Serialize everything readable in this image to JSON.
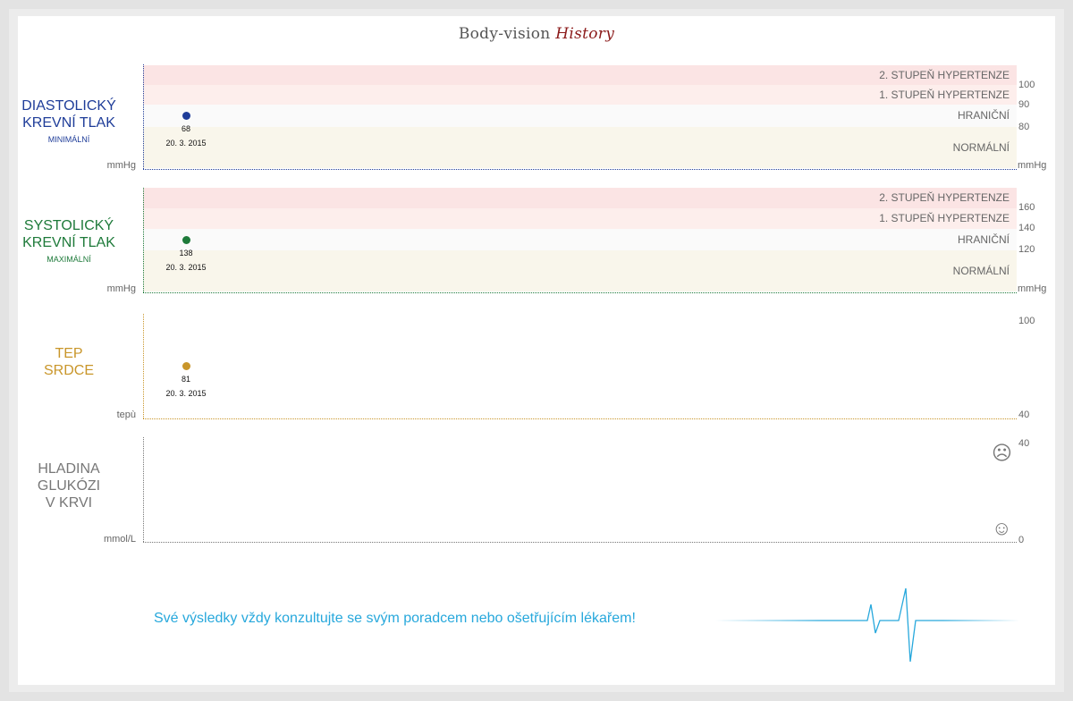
{
  "header": {
    "title_part1": "Body-vision",
    "title_part2": "History"
  },
  "diastolic": {
    "title_line1": "DIASTOLICKÝ",
    "title_line2": "KREVNÍ TLAK",
    "subtitle": "MINIMÁLNÍ",
    "unit": "mmHg",
    "color": "#1f3d99",
    "zones": [
      "2. STUPEŇ HYPERTENZE",
      "1. STUPEŇ HYPERTENZE",
      "HRANIČNÍ",
      "NORMÁLNÍ"
    ],
    "ticks": [
      "100",
      "90",
      "80"
    ],
    "reading": {
      "value": "68",
      "date": "20. 3. 2015"
    }
  },
  "systolic": {
    "title_line1": "SYSTOLICKÝ",
    "title_line2": "KREVNÍ TLAK",
    "subtitle": "MAXIMÁLNÍ",
    "unit": "mmHg",
    "color": "#1e7a3a",
    "zones": [
      "2. STUPEŇ HYPERTENZE",
      "1. STUPEŇ HYPERTENZE",
      "HRANIČNÍ",
      "NORMÁLNÍ"
    ],
    "ticks": [
      "160",
      "140",
      "120"
    ],
    "reading": {
      "value": "138",
      "date": "20. 3. 2015"
    }
  },
  "heart": {
    "title_line1": "TEP",
    "title_line2": "SRDCE",
    "unit": "tepù",
    "color": "#c9962a",
    "ticks": [
      "100",
      "40"
    ],
    "reading": {
      "value": "81",
      "date": "20. 3. 2015"
    }
  },
  "glucose": {
    "title_line1": "HLADINA",
    "title_line2": "GLUKÓZI",
    "title_line3": "V KRVI",
    "unit": "mmol/L",
    "color": "#777777",
    "ticks": [
      "40",
      "0"
    ],
    "faces": {
      "top": "☹",
      "bottom": "☺"
    }
  },
  "footer": {
    "message": "Své výsledky vždy konzultujte se svým poradcem nebo ošetřujícím lékařem!"
  },
  "colors": {
    "zone_hyper2": "#fbe4e4",
    "zone_hyper1": "#fdeeec",
    "zone_border": "#fafafa",
    "zone_normal": "#f9f6eb",
    "ecg": "#27a8dc"
  }
}
